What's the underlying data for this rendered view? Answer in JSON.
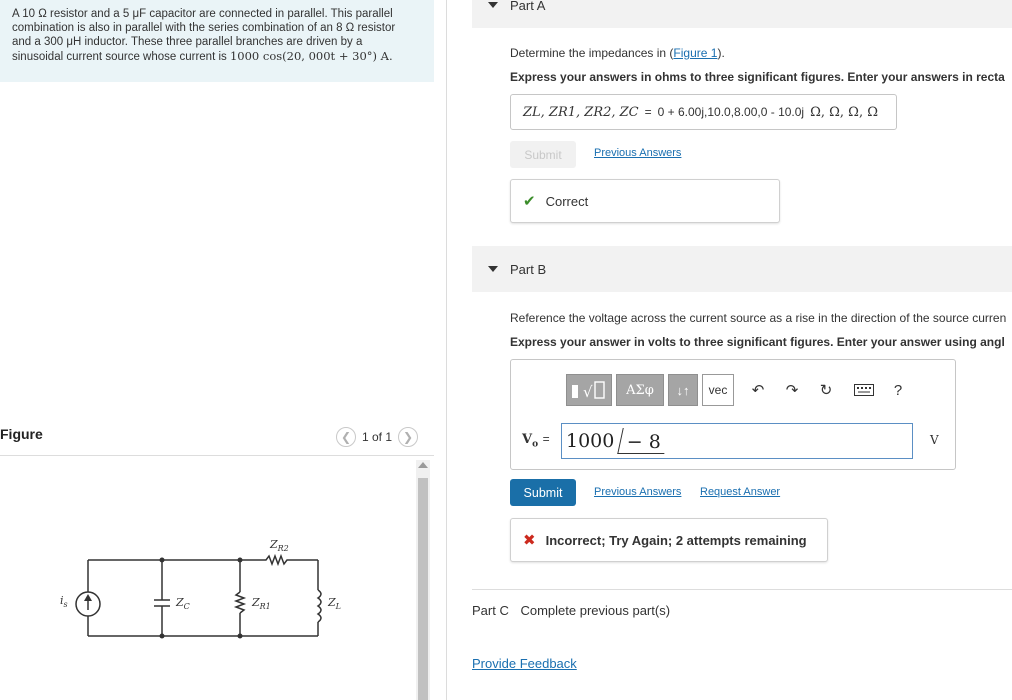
{
  "problem": {
    "text_line1": "A 10 Ω resistor and a 5 μF capacitor are connected in parallel. This parallel",
    "text_line2": "combination is also in parallel with the series combination of an 8 Ω resistor",
    "text_line3": "and a 300 μH inductor. These three parallel branches are driven by a",
    "text_line4_prefix": "sinusoidal current source whose current is",
    "text_line4_math": "1000 cos(20, 000t + 30°) A."
  },
  "figure": {
    "title": "Figure",
    "pager": "1 of 1",
    "labels": {
      "is": "i",
      "is_sub": "s",
      "zc": "Z",
      "zc_sub": "C",
      "zr1": "Z",
      "zr1_sub": "R1",
      "zr2": "Z",
      "zr2_sub": "R2",
      "zl": "Z",
      "zl_sub": "L"
    }
  },
  "partA": {
    "label": "Part A",
    "prompt_prefix": "Determine the impedances in (",
    "prompt_link": "Figure 1",
    "prompt_suffix": ").",
    "instruction": "Express your answers in ohms to three significant figures. Enter your answers in recta",
    "answer_vars": "ZL, ZR1, ZR2, ZC",
    "answer_equals": "=",
    "answer_value": "0 + 6.00j,10.0,8.00,0 - 10.0j",
    "answer_units": "Ω, Ω, Ω, Ω",
    "submit_label": "Submit",
    "previous_answers": "Previous Answers",
    "feedback": "Correct"
  },
  "partB": {
    "label": "Part B",
    "prompt": "Reference the voltage across the current source as a rise in the direction of the source curren",
    "instruction": "Express your answer in volts to three significant figures. Enter your answer using angl",
    "toolbar": [
      "√",
      "ΑΣφ",
      "↓↑",
      "vec"
    ],
    "var_label": "V",
    "var_sub": "o",
    "var_equals": "=",
    "input_magnitude": "1000",
    "input_angle": "− 8",
    "unit": "V",
    "submit_label": "Submit",
    "previous_answers": "Previous Answers",
    "request_answer": "Request Answer",
    "feedback": "Incorrect; Try Again; 2 attempts remaining"
  },
  "partC": {
    "label": "Part C",
    "status": "Complete previous part(s)"
  },
  "provide_feedback": "Provide Feedback"
}
